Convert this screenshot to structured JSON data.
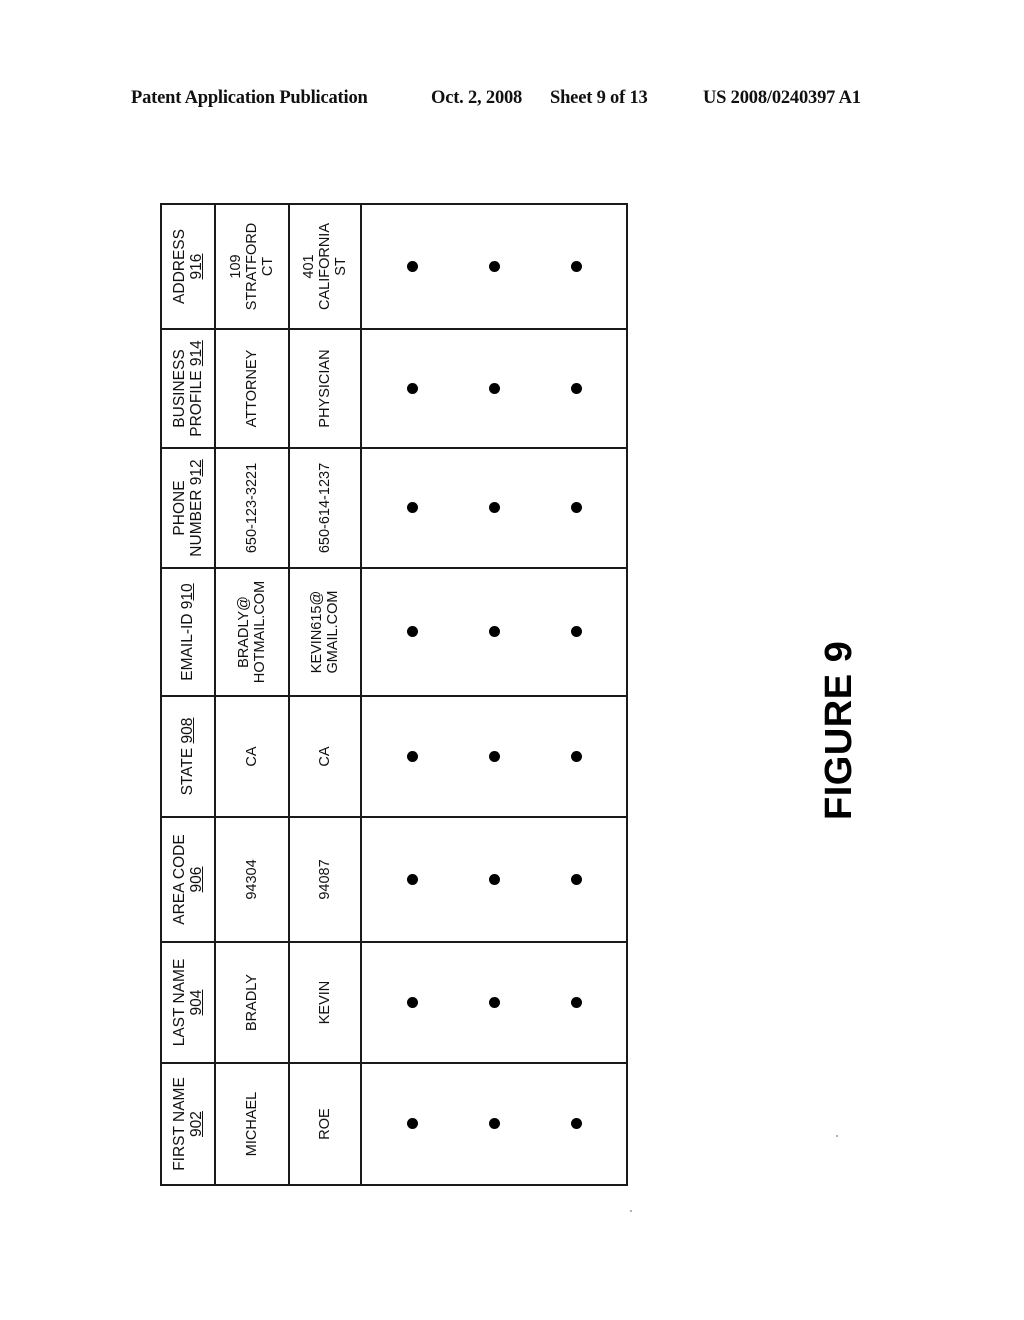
{
  "header": {
    "publication": "Patent Application Publication",
    "date": "Oct. 2, 2008",
    "sheet": "Sheet 9 of 13",
    "number": "US 2008/0240397 A1"
  },
  "table": {
    "columns": [
      {
        "label": "FIRST NAME",
        "ref": "902"
      },
      {
        "label": "LAST NAME",
        "ref": "904"
      },
      {
        "label": "AREA CODE",
        "ref": "906"
      },
      {
        "label": "STATE",
        "ref": "908"
      },
      {
        "label": "EMAIL-ID 9",
        "ref": "10"
      },
      {
        "label": "PHONE NUMBER 9",
        "ref": "12"
      },
      {
        "label": "BUSINESS PROFILE",
        "ref": "914"
      },
      {
        "label": "ADDRESS",
        "ref": "916"
      }
    ],
    "rows": [
      {
        "first_name": "MICHAEL",
        "last_name": "BRADLY",
        "area_code": "94304",
        "state": "CA",
        "email_line1": "BRADLY@",
        "email_line2": "HOTMAIL.COM",
        "phone": "650-123-3221",
        "business_profile": "ATTORNEY",
        "address_line1": "109",
        "address_line2": "STRATFORD",
        "address_line3": "CT"
      },
      {
        "first_name": "ROE",
        "last_name": "KEVIN",
        "area_code": "94087",
        "state": "CA",
        "email_line1": "KEVIN615@",
        "email_line2": "GMAIL.COM",
        "phone": "650-614-1237",
        "business_profile": "PHYSICIAN",
        "address_line1": "401",
        "address_line2": "CALIFORNIA",
        "address_line3": "ST"
      }
    ],
    "continuation_marker": "ellipsis-dots"
  },
  "figure": {
    "label": "FIGURE 9"
  }
}
